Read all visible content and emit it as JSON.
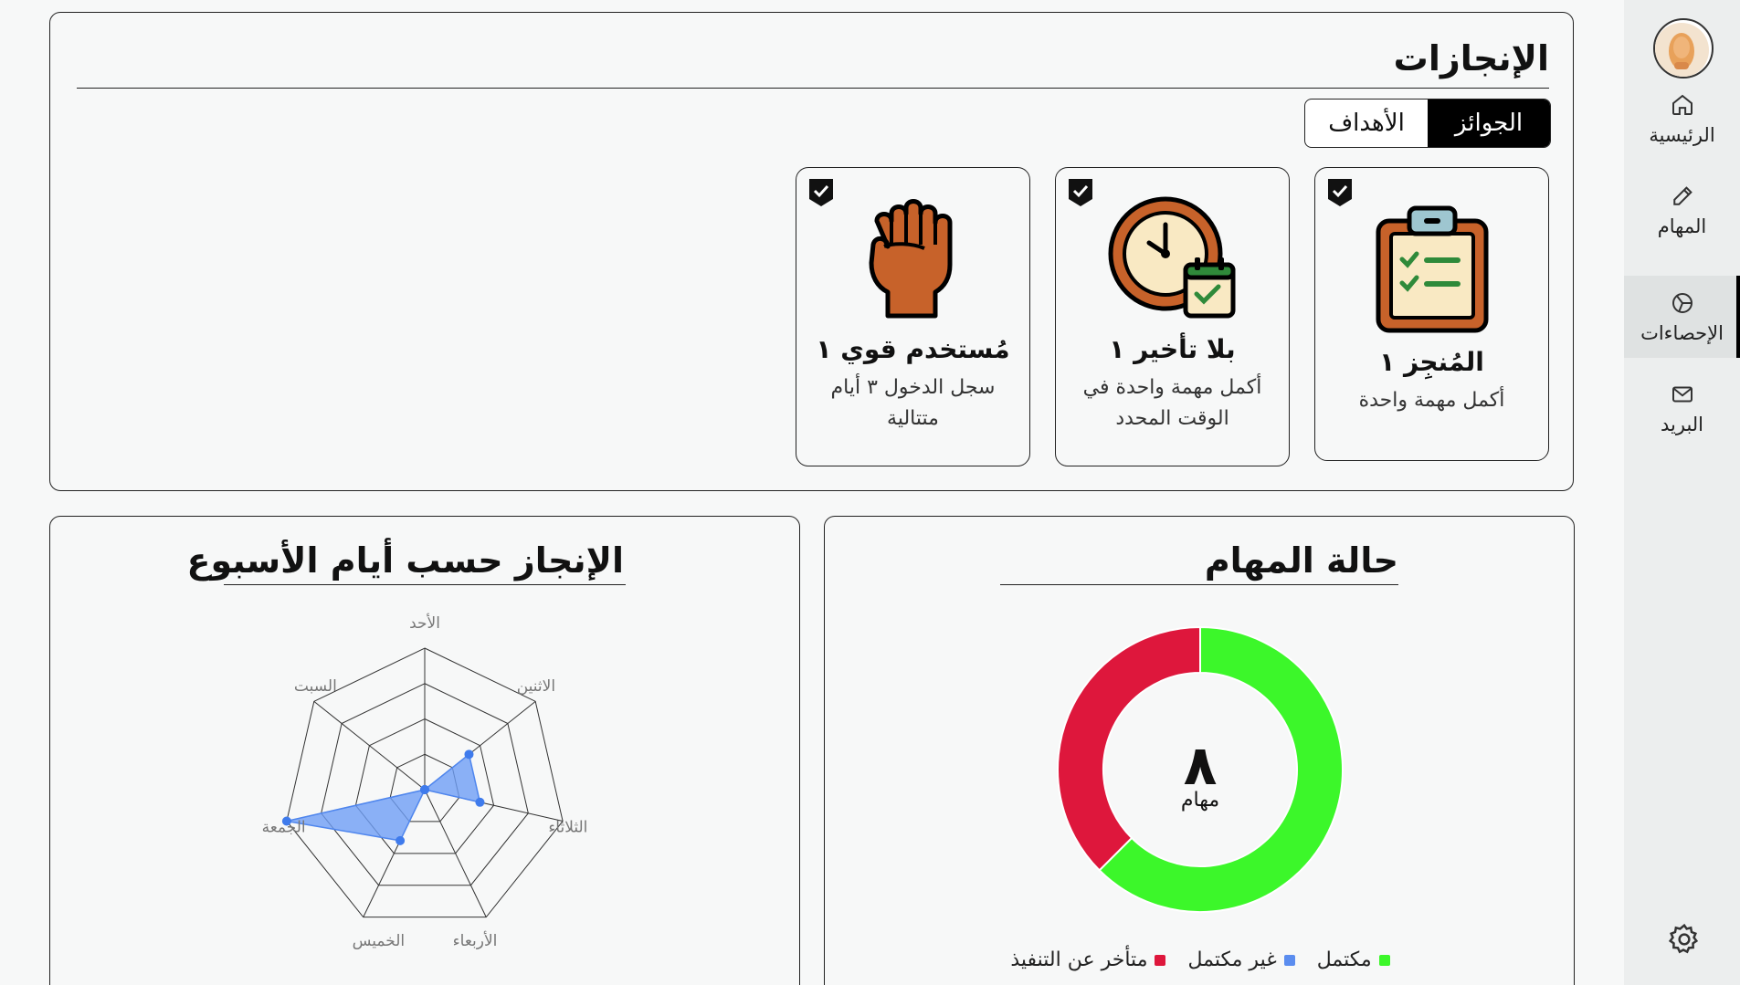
{
  "sidebar": {
    "items": [
      {
        "label": "الرئيسية",
        "icon": "home-icon"
      },
      {
        "label": "المهام",
        "icon": "pencil-icon"
      },
      {
        "label": "الإحصاءات",
        "icon": "pie-chart-icon"
      },
      {
        "label": "البريد",
        "icon": "mail-icon"
      }
    ],
    "active_index": 2,
    "settings_icon": "gear-icon"
  },
  "achievements": {
    "title": "الإنجازات",
    "tabs": [
      {
        "label": "الجوائز",
        "active": true
      },
      {
        "label": "الأهداف",
        "active": false
      }
    ],
    "cards": [
      {
        "title": "المُنجِز ١",
        "description": "أكمل مهمة واحدة",
        "icon": "clipboard-checklist-icon",
        "unlocked": true
      },
      {
        "title": "بلا تأخير ١",
        "description": "أكمل مهمة واحدة في الوقت المحدد",
        "icon": "clock-calendar-icon",
        "unlocked": true
      },
      {
        "title": "مُستخدم قوي ١",
        "description": "سجل الدخول ٣ أيام متتالية",
        "icon": "fist-icon",
        "unlocked": true
      }
    ]
  },
  "weekday_chart": {
    "title": "الإنجاز حسب أيام الأسبوع",
    "chart_data": {
      "type": "radar",
      "categories": [
        "الأحد",
        "الاثنين",
        "الثلاثاء",
        "الأربعاء",
        "الخميس",
        "الجمعة",
        "السبت"
      ],
      "values": [
        0,
        2,
        2,
        0,
        2,
        5,
        0
      ],
      "max": 5,
      "rings": 4,
      "color": "#6e9ef5"
    }
  },
  "status_chart": {
    "title": "حالة المهام",
    "center_value": "٨",
    "center_label": "مهام",
    "chart_data": {
      "type": "pie",
      "categories": [
        "مكتمل",
        "غير مكتمل",
        "متأخر عن التنفيذ"
      ],
      "values": [
        5,
        0,
        3
      ],
      "colors": [
        "#3cf72a",
        "#5b8def",
        "#de173c"
      ]
    }
  }
}
